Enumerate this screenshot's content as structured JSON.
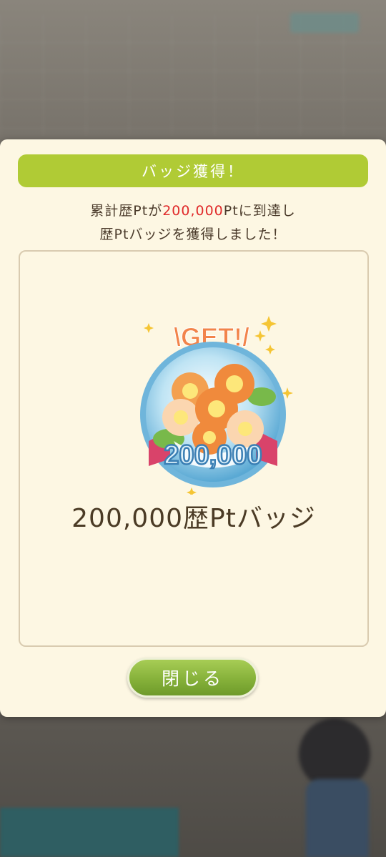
{
  "dialog": {
    "title": "バッジ獲得！",
    "message_part1": "累計歴Ptが",
    "message_highlight": "200,000",
    "message_part2": "Ptに到達し",
    "message_line2": "歴Ptバッジを獲得しました！",
    "badge_get_label": "\\GET!/",
    "badge_number": "200,000",
    "badge_name": "200,000歴Ptバッジ",
    "close_label": "閉じる"
  },
  "colors": {
    "title_bar": "#b0cb35",
    "highlight": "#e02a2a",
    "dialog_bg": "#fdf7e3",
    "close_button": "#86b13a"
  }
}
